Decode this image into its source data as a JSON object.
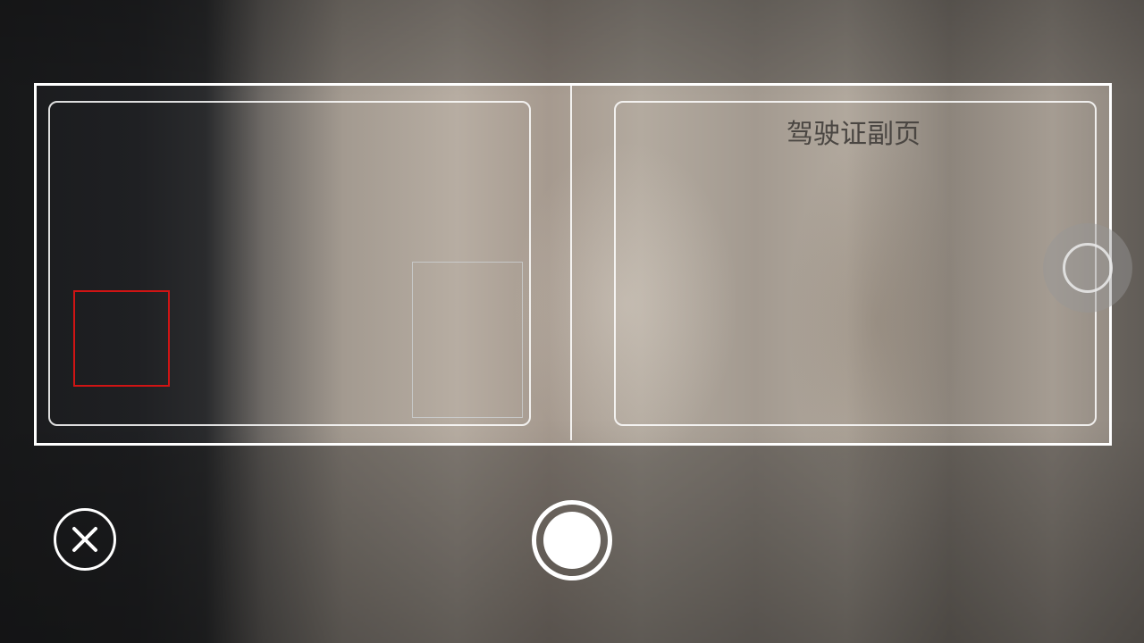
{
  "scanner": {
    "right_card_label": "驾驶证副页"
  },
  "colors": {
    "frame": "#ffffff",
    "photo_guide": "#d01414",
    "label_text": "#4a4642"
  },
  "controls": {
    "close_icon": "close-icon",
    "shutter_icon": "shutter-icon",
    "flip_icon": "flip-icon"
  }
}
